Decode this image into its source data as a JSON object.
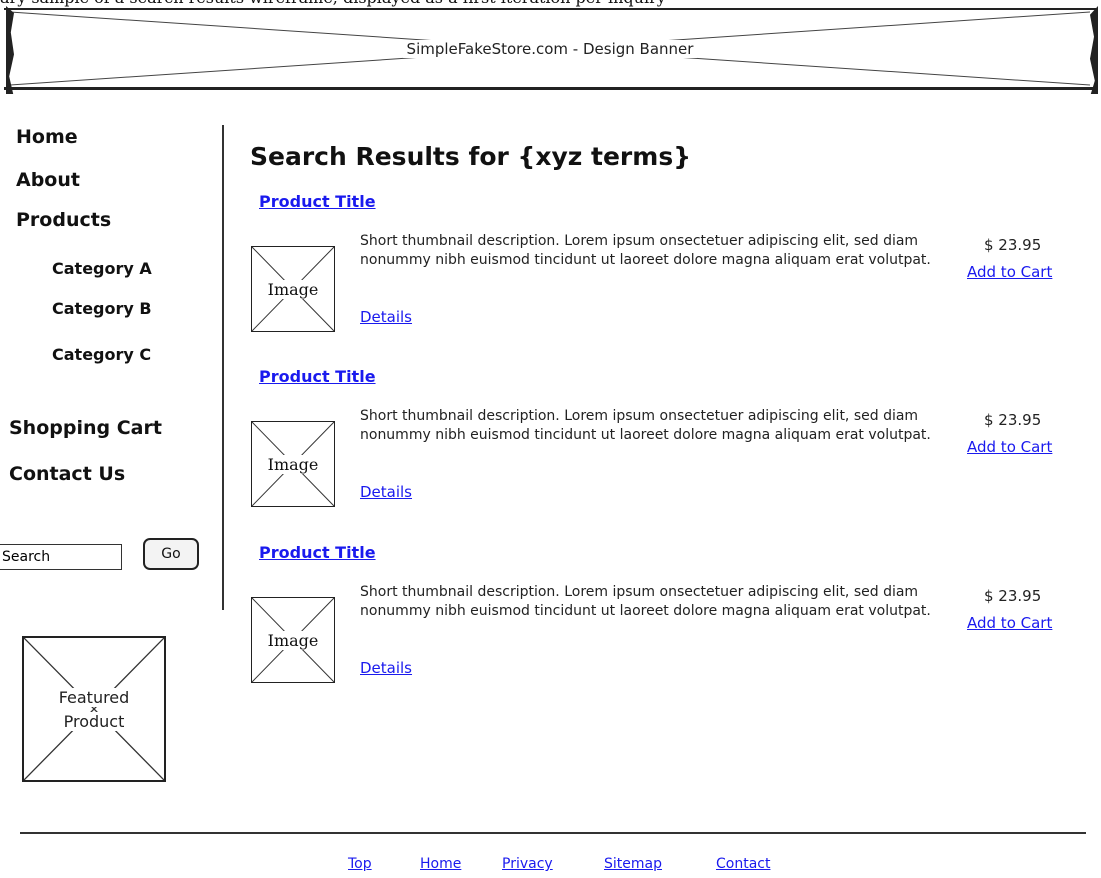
{
  "top_caption": "ary sample of a search results wireframe, displayed as a first iteration per inquiry",
  "banner": {
    "text": "SimpleFakeStore.com  -  Design Banner"
  },
  "sidebar": {
    "nav": {
      "home": "Home",
      "about": "About",
      "products": "Products",
      "category_a": "Category A",
      "category_b": "Category B",
      "category_c": "Category C",
      "shopping_cart": "Shopping Cart",
      "contact_us": "Contact Us"
    },
    "search": {
      "placeholder": "Search",
      "value": "Search",
      "button": "Go"
    },
    "featured": {
      "line1": "Featured",
      "line2": "Product"
    }
  },
  "main": {
    "title": "Search Results for {xyz terms}",
    "products": [
      {
        "title": "Product Title",
        "image_label": "Image",
        "description": "Short thumbnail description. Lorem ipsum onsectetuer adipiscing elit, sed diam nonummy nibh euismod tincidunt ut laoreet dolore magna aliquam erat volutpat.",
        "details": "Details",
        "price": "$ 23.95",
        "add_to_cart": "Add to Cart"
      },
      {
        "title": "Product Title",
        "image_label": "Image",
        "description": "Short thumbnail description. Lorem ipsum onsectetuer adipiscing elit, sed diam nonummy nibh euismod tincidunt ut laoreet dolore magna aliquam erat volutpat.",
        "details": "Details",
        "price": "$ 23.95",
        "add_to_cart": "Add to Cart"
      },
      {
        "title": "Product Title",
        "image_label": "Image",
        "description": "Short thumbnail description. Lorem ipsum onsectetuer adipiscing elit, sed diam nonummy nibh euismod tincidunt ut laoreet dolore magna aliquam erat volutpat.",
        "details": "Details",
        "price": "$ 23.95",
        "add_to_cart": "Add to Cart"
      }
    ]
  },
  "footer": {
    "links": [
      "Top",
      "Home",
      "Privacy",
      "Sitemap",
      "Contact"
    ]
  },
  "colors": {
    "link": "#1a1aee",
    "ink": "#222222",
    "background": "#ffffff"
  }
}
